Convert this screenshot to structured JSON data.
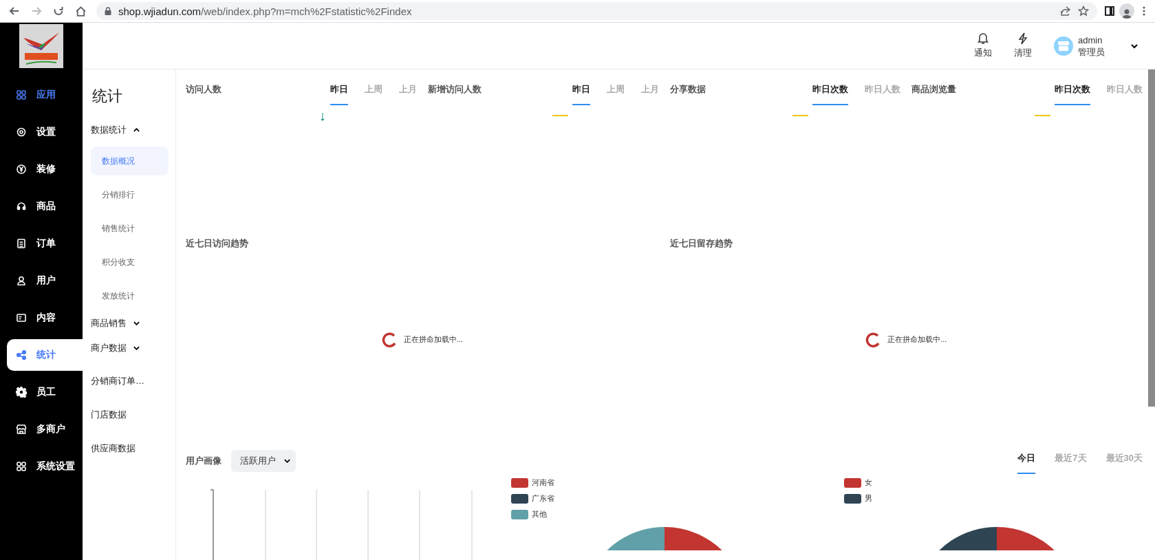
{
  "browser": {
    "url_host": "shop.wjiadun.com",
    "url_path": "/web/index.php?m=mch%2Fstatistic%2Findex"
  },
  "header": {
    "actions": [
      {
        "kind": "bell",
        "label": "通知"
      },
      {
        "kind": "bolt",
        "label": "清理"
      }
    ],
    "user": {
      "name": "admin",
      "role": "管理员"
    }
  },
  "nav": [
    {
      "kind": "apps",
      "label": "应用",
      "highlighted": true,
      "selected": false
    },
    {
      "kind": "gear",
      "label": "设置",
      "highlighted": false,
      "selected": false
    },
    {
      "kind": "yen",
      "label": "装修",
      "highlighted": false,
      "selected": false
    },
    {
      "kind": "headset",
      "label": "商品",
      "highlighted": false,
      "selected": false
    },
    {
      "kind": "doc",
      "label": "订单",
      "highlighted": false,
      "selected": false
    },
    {
      "kind": "user",
      "label": "用户",
      "highlighted": false,
      "selected": false
    },
    {
      "kind": "card",
      "label": "内容",
      "highlighted": false,
      "selected": false
    },
    {
      "kind": "share",
      "label": "统计",
      "highlighted": false,
      "selected": true
    },
    {
      "kind": "cog",
      "label": "员工",
      "highlighted": false,
      "selected": false
    },
    {
      "kind": "store",
      "label": "多商户",
      "highlighted": false,
      "selected": false
    },
    {
      "kind": "apps",
      "label": "系统设置",
      "highlighted": false,
      "selected": false
    }
  ],
  "subnav": {
    "title": "统计",
    "items": [
      {
        "kind": "group",
        "label": "数据统计",
        "expanded": true,
        "children": [
          {
            "label": "数据概况",
            "selected": true
          },
          {
            "label": "分销排行",
            "selected": false
          },
          {
            "label": "销售统计",
            "selected": false
          },
          {
            "label": "积分收支",
            "selected": false
          },
          {
            "label": "发放统计",
            "selected": false
          }
        ]
      },
      {
        "kind": "group",
        "label": "商品销售",
        "expanded": false
      },
      {
        "kind": "group",
        "label": "商户数据",
        "expanded": false
      },
      {
        "kind": "link",
        "label": "分销商订单…"
      },
      {
        "kind": "link",
        "label": "门店数据"
      },
      {
        "kind": "link",
        "label": "供应商数据"
      }
    ]
  },
  "stats": [
    {
      "title": "访问人数",
      "tabs": [
        {
          "label": "昨日",
          "selected": true
        },
        {
          "label": "上周",
          "selected": false
        },
        {
          "label": "上月",
          "selected": false
        }
      ],
      "indicator": {
        "kind": "arrow",
        "text": "↓"
      }
    },
    {
      "title": "新增访问人数",
      "tabs": [
        {
          "label": "昨日",
          "selected": true
        },
        {
          "label": "上周",
          "selected": false
        },
        {
          "label": "上月",
          "selected": false
        }
      ],
      "indicator": {
        "kind": "dash"
      }
    },
    {
      "title": "分享数据",
      "tabs": [
        {
          "label": "昨日次数",
          "selected": true
        },
        {
          "label": "昨日人数",
          "selected": false
        }
      ],
      "indicator": {
        "kind": "dash"
      }
    },
    {
      "title": "商品浏览量",
      "tabs": [
        {
          "label": "昨日次数",
          "selected": true
        },
        {
          "label": "昨日人数",
          "selected": false
        }
      ],
      "indicator": {
        "kind": "dash"
      }
    }
  ],
  "trends": [
    {
      "title": "近七日访问趋势",
      "loading": "正在拼命加载中..."
    },
    {
      "title": "近七日留存趋势",
      "loading": "正在拼命加载中..."
    }
  ],
  "portrait": {
    "title": "用户画像",
    "select": "活跃用户",
    "ranges": [
      {
        "label": "今日",
        "selected": true
      },
      {
        "label": "最近7天",
        "selected": false
      },
      {
        "label": "最近30天",
        "selected": false
      }
    ],
    "region_legend": [
      {
        "label": "河南省",
        "color": "#c23531"
      },
      {
        "label": "广东省",
        "color": "#2f4554"
      },
      {
        "label": "其他",
        "color": "#61a0a8"
      }
    ],
    "gender_legend": [
      {
        "label": "女",
        "color": "#c23531"
      },
      {
        "label": "男",
        "color": "#2f4554"
      }
    ]
  }
}
